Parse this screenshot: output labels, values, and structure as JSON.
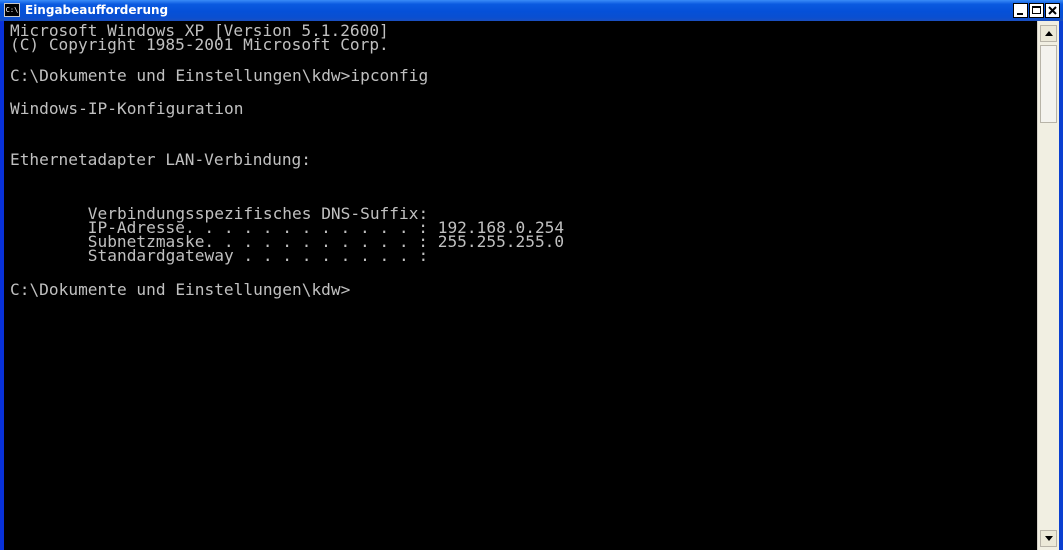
{
  "window": {
    "title": "Eingabeaufforderung",
    "icon_label": "C:\\"
  },
  "console": {
    "lines": [
      "Microsoft Windows XP [Version 5.1.2600]",
      "(C) Copyright 1985-2001 Microsoft Corp.",
      "C:\\Dokumente und Einstellungen\\kdw>ipconfig",
      "Windows-IP-Konfiguration",
      "Ethernetadapter LAN-Verbindung:",
      "        Verbindungsspezifisches DNS-Suffix:",
      "        IP-Adresse. . . . . . . . . . . . : 192.168.0.254",
      "        Subnetzmaske. . . . . . . . . . . : 255.255.255.0",
      "        Standardgateway . . . . . . . . . :",
      "C:\\Dokumente und Einstellungen\\kdw>"
    ]
  },
  "colors": {
    "console_background": "#000000",
    "console_text": "#c0c0c0",
    "titlebar": "#0a5ae0"
  },
  "icons": {
    "app": "console-app-icon",
    "minimize": "minimize-icon",
    "maximize": "maximize-icon",
    "close": "close-icon",
    "scroll_up": "arrow-up-icon",
    "scroll_down": "arrow-down-icon"
  }
}
